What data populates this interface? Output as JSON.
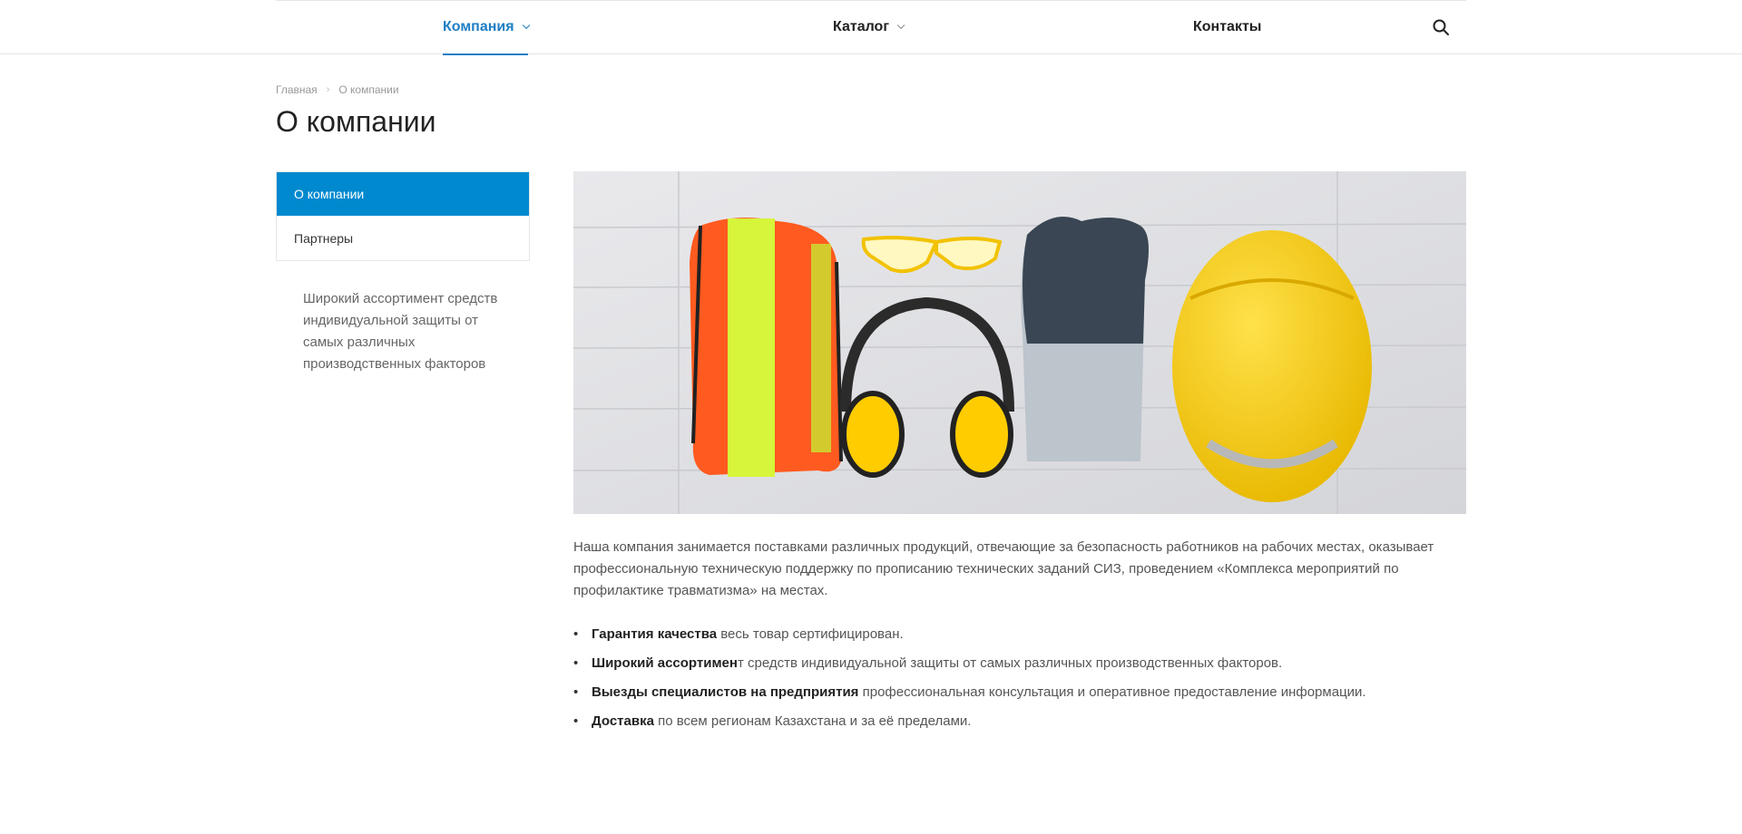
{
  "header": {
    "nav": [
      {
        "label": "Компания",
        "active": true
      },
      {
        "label": "Каталог",
        "active": false
      },
      {
        "label": "Контакты",
        "active": false
      }
    ],
    "search_icon": "search-icon",
    "accent_color": "#1e7ec4"
  },
  "breadcrumb": {
    "home": "Главная",
    "current": "О компании"
  },
  "page": {
    "title": "О компании"
  },
  "sidebar": {
    "items": [
      {
        "label": "О компании",
        "active": true
      },
      {
        "label": "Партнеры",
        "active": false
      }
    ],
    "active_color": "#0089cf",
    "tagline": "Широкий ассортимент средств индивидуальной защиты от самых различных производственных факторов"
  },
  "main": {
    "intro": "Наша компания занимается поставками различных продукций, отвечающие за безопасность работников на рабочих местах, оказывает профессиональную техническую поддержку по прописанию технических заданий СИЗ, проведением «Комплекса мероприятий по профилактике травматизма» на местах.",
    "features": [
      {
        "bold": "Гарантия качества",
        "text": " весь товар сертифицирован."
      },
      {
        "bold": "Широкий ассортимен",
        "text": "т средств индивидуальной защиты от самых различных производственных факторов."
      },
      {
        "bold": "Выезды специалистов на предприятия",
        "text": " профессиональная консультация и оперативное предоставление информации."
      },
      {
        "bold": "Доставка",
        "text": " по всем регионам Казахстана и за её пределами."
      }
    ]
  }
}
